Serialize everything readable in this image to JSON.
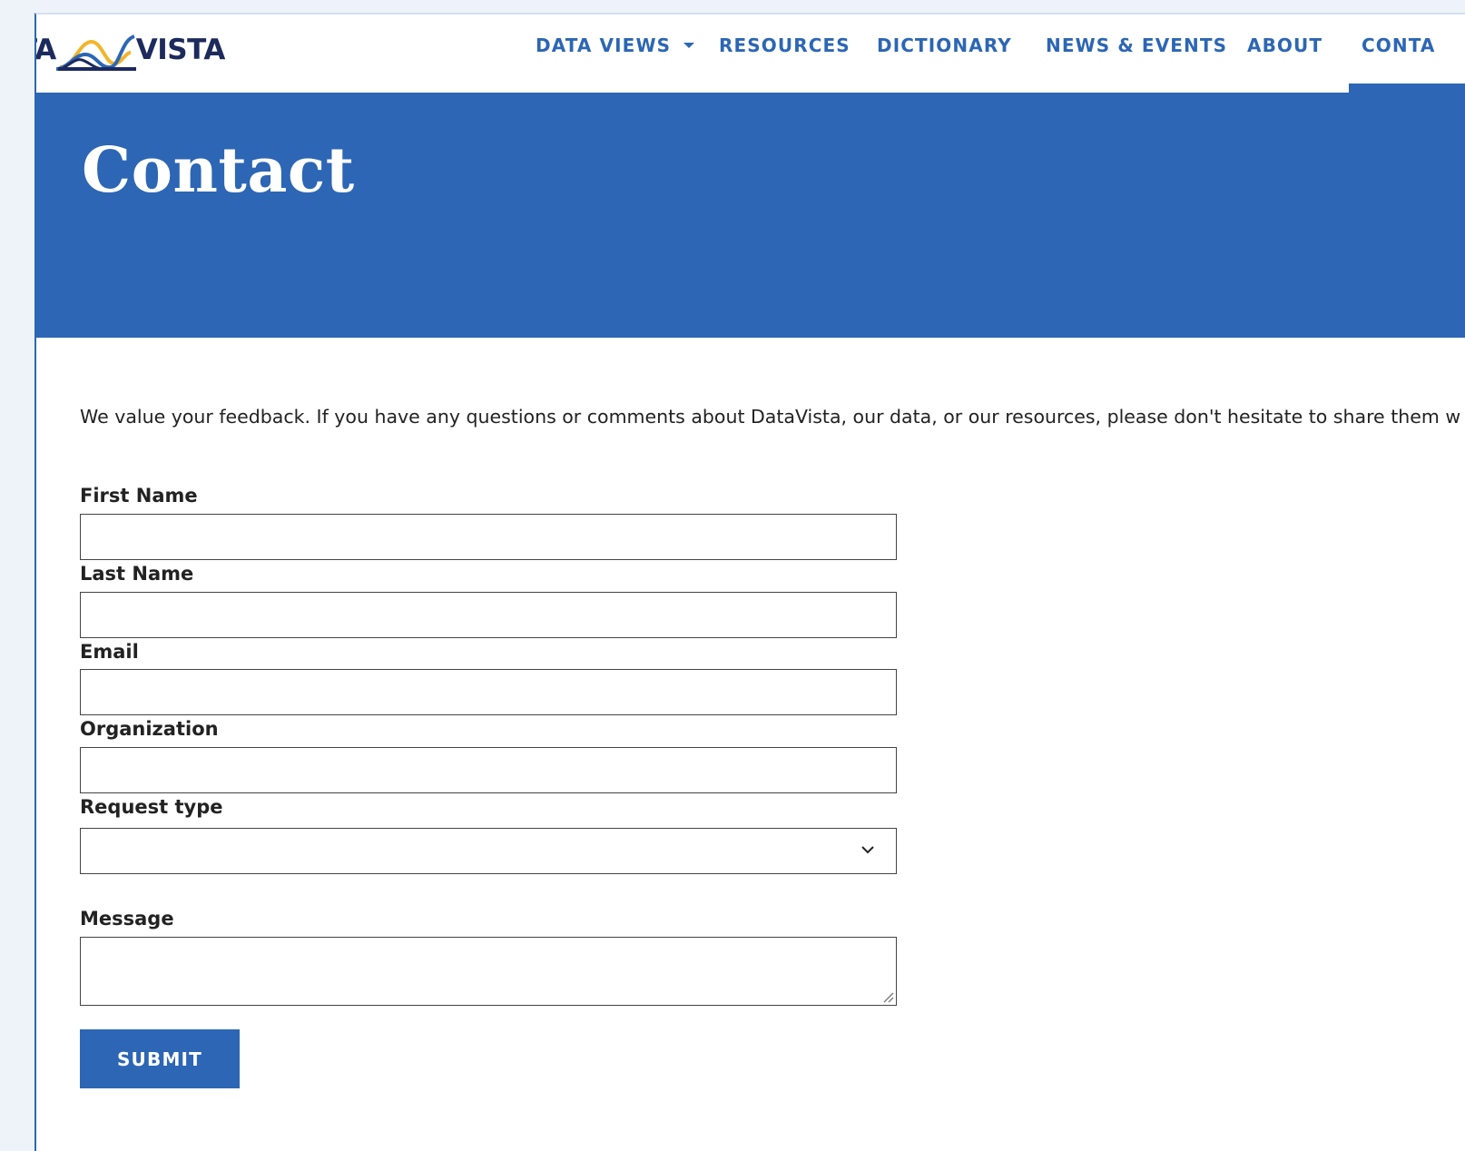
{
  "header": {
    "logo": {
      "left_text": "TA",
      "right_text": "VISTA",
      "colors": {
        "navy": "#1c2a5c",
        "gold": "#f1b52d",
        "blue": "#2c66b5"
      }
    },
    "nav": {
      "items": [
        {
          "label": "DATA VIEWS",
          "has_dropdown": true
        },
        {
          "label": "RESOURCES"
        },
        {
          "label": "DICTIONARY"
        },
        {
          "label": "NEWS & EVENTS"
        },
        {
          "label": "ABOUT"
        },
        {
          "label": "CONTA",
          "active": true
        }
      ]
    }
  },
  "hero": {
    "title": "Contact",
    "background": "#2c66b5"
  },
  "main": {
    "intro": "We value your feedback. If you have any questions or comments about DataVista, our data, or our resources, please don't hesitate to share them w",
    "form": {
      "fields": [
        {
          "label": "First Name",
          "value": ""
        },
        {
          "label": "Last Name",
          "value": ""
        },
        {
          "label": "Email",
          "value": ""
        },
        {
          "label": "Organization",
          "value": ""
        }
      ],
      "request_type": {
        "label": "Request type",
        "selected": ""
      },
      "message": {
        "label": "Message",
        "value": ""
      },
      "submit_label": "SUBMIT"
    }
  },
  "icons": {
    "nav_dropdown": "caret-down-icon",
    "select": "chevron-down-icon",
    "textarea": "resize-handle-icon"
  },
  "colors": {
    "accent": "#2c66b5",
    "text": "#222222",
    "page_background": "#eef3f9"
  }
}
